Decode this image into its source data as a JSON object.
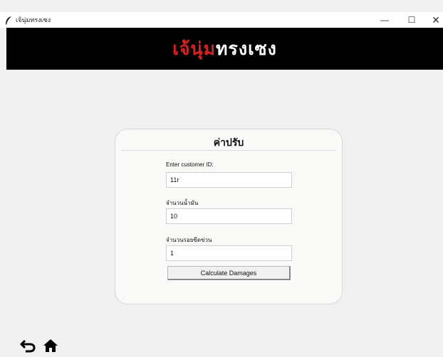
{
  "window": {
    "title": "เจ้นุ่มทรงเซง",
    "minimize_glyph": "—",
    "maximize_glyph": "☐",
    "close_glyph": "✕"
  },
  "banner": {
    "logo_part1": "เจ้นุ่ม",
    "logo_part2": "ทรงเซง",
    "logo_color_1": "#e01e1e",
    "logo_color_2": "#ffffff",
    "background": "#000000"
  },
  "form": {
    "title": "ค่าปรับ",
    "fields": [
      {
        "label": "Enter customer ID:",
        "value": "11r"
      },
      {
        "label": "จำนวนน้ำมัน",
        "value": "10"
      },
      {
        "label": "จำนวนรอยขีดข่วน",
        "value": "1"
      }
    ],
    "submit_label": "Calculate Damages"
  },
  "nav": {
    "back_icon": "back-arrow-icon",
    "home_icon": "home-icon"
  }
}
